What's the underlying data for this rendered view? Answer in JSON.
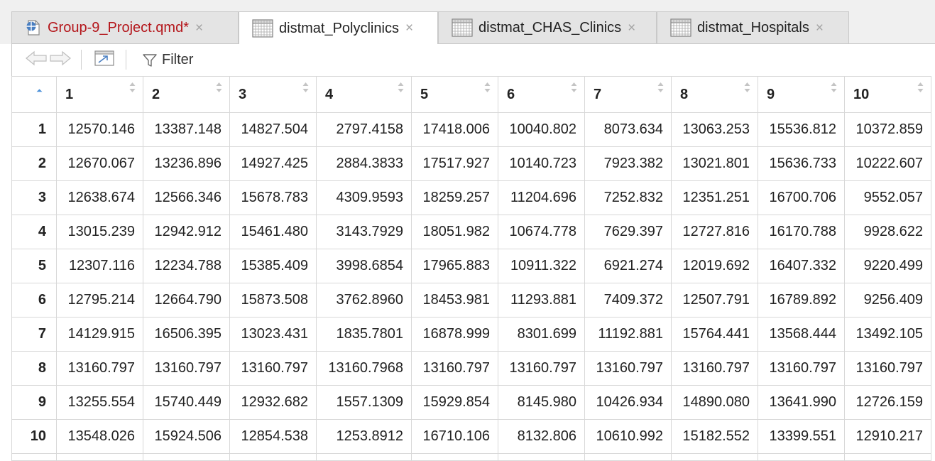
{
  "tabs": [
    {
      "label": "Group-9_Project.qmd*",
      "icon": "quarto-doc-icon",
      "active": false,
      "close": "×"
    },
    {
      "label": "distmat_Polyclinics",
      "icon": "table-icon",
      "active": true,
      "close": "×"
    },
    {
      "label": "distmat_CHAS_Clinics",
      "icon": "table-icon",
      "active": false,
      "close": "×"
    },
    {
      "label": "distmat_Hospitals",
      "icon": "table-icon",
      "active": false,
      "close": "×"
    }
  ],
  "toolbar": {
    "back_icon": "arrow-left-icon",
    "forward_icon": "arrow-right-icon",
    "popout_icon": "popout-window-icon",
    "filter_label": "Filter",
    "filter_icon": "funnel-icon"
  },
  "table": {
    "columns": [
      "1",
      "2",
      "3",
      "4",
      "5",
      "6",
      "7",
      "8",
      "9",
      "10"
    ],
    "rows": [
      {
        "num": "1",
        "cells": [
          "12570.146",
          "13387.148",
          "14827.504",
          "2797.4158",
          "17418.006",
          "10040.802",
          "8073.634",
          "13063.253",
          "15536.812",
          "10372.859"
        ]
      },
      {
        "num": "2",
        "cells": [
          "12670.067",
          "13236.896",
          "14927.425",
          "2884.3833",
          "17517.927",
          "10140.723",
          "7923.382",
          "13021.801",
          "15636.733",
          "10222.607"
        ]
      },
      {
        "num": "3",
        "cells": [
          "12638.674",
          "12566.346",
          "15678.783",
          "4309.9593",
          "18259.257",
          "11204.696",
          "7252.832",
          "12351.251",
          "16700.706",
          "9552.057"
        ]
      },
      {
        "num": "4",
        "cells": [
          "13015.239",
          "12942.912",
          "15461.480",
          "3143.7929",
          "18051.982",
          "10674.778",
          "7629.397",
          "12727.816",
          "16170.788",
          "9928.622"
        ]
      },
      {
        "num": "5",
        "cells": [
          "12307.116",
          "12234.788",
          "15385.409",
          "3998.6854",
          "17965.883",
          "10911.322",
          "6921.274",
          "12019.692",
          "16407.332",
          "9220.499"
        ]
      },
      {
        "num": "6",
        "cells": [
          "12795.214",
          "12664.790",
          "15873.508",
          "3762.8960",
          "18453.981",
          "11293.881",
          "7409.372",
          "12507.791",
          "16789.892",
          "9256.409"
        ]
      },
      {
        "num": "7",
        "cells": [
          "14129.915",
          "16506.395",
          "13023.431",
          "1835.7801",
          "16878.999",
          "8301.699",
          "11192.881",
          "15764.441",
          "13568.444",
          "13492.105"
        ]
      },
      {
        "num": "8",
        "cells": [
          "13160.797",
          "13160.797",
          "13160.797",
          "13160.7968",
          "13160.797",
          "13160.797",
          "13160.797",
          "13160.797",
          "13160.797",
          "13160.797"
        ]
      },
      {
        "num": "9",
        "cells": [
          "13255.554",
          "15740.449",
          "12932.682",
          "1557.1309",
          "15929.854",
          "8145.980",
          "10426.934",
          "14890.080",
          "13641.990",
          "12726.159"
        ]
      },
      {
        "num": "10",
        "cells": [
          "13548.026",
          "15924.506",
          "12854.538",
          "1253.8912",
          "16710.106",
          "8132.806",
          "10610.992",
          "15182.552",
          "13399.551",
          "12910.217"
        ]
      }
    ]
  },
  "colors": {
    "modified_doc_title": "#b4161b",
    "sort_active": "#4a90d9",
    "sort_inactive": "#c4c4c4"
  }
}
